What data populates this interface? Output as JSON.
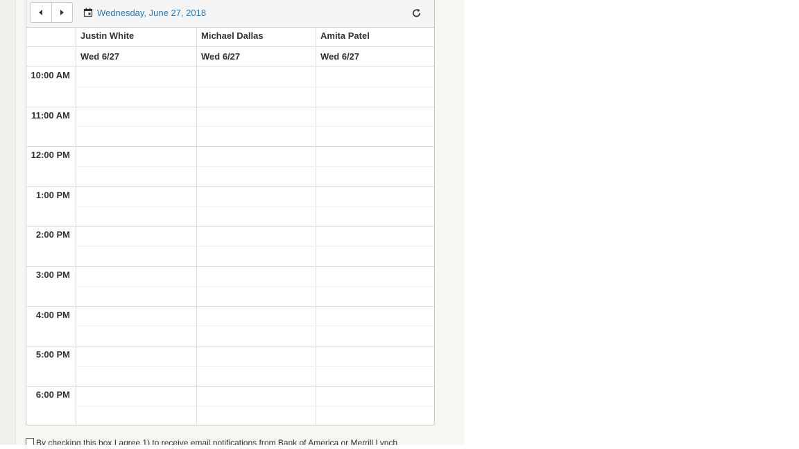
{
  "toolbar": {
    "date_label": "Wednesday, June 27, 2018",
    "prev_icon": "caret-left-icon",
    "next_icon": "caret-right-icon",
    "calendar_icon": "calendar-icon",
    "refresh_icon": "refresh-icon"
  },
  "resources": [
    {
      "name": "Justin White",
      "day": "Wed 6/27"
    },
    {
      "name": "Michael Dallas",
      "day": "Wed 6/27"
    },
    {
      "name": "Amita Patel",
      "day": "Wed 6/27"
    }
  ],
  "times": [
    "10:00 AM",
    "11:00 AM",
    "12:00 PM",
    "1:00 PM",
    "2:00 PM",
    "3:00 PM",
    "4:00 PM",
    "5:00 PM",
    "6:00 PM"
  ],
  "consent": {
    "text": "By checking this box I agree 1) to receive email notifications from Bank of America or Merrill Lynch",
    "checked": false
  },
  "colors": {
    "link": "#2a7ab8",
    "panel_bg": "#f7f6f2",
    "grid_line": "#dcdcdc"
  }
}
